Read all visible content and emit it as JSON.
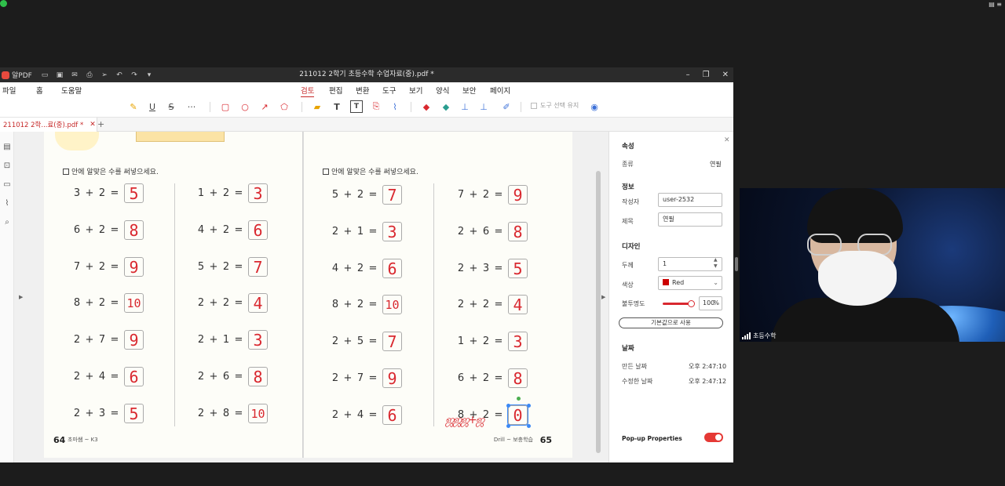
{
  "app": {
    "name": "알PDF",
    "window_title": "211012 2학기 초등수학 수업자료(중).pdf *"
  },
  "menu": [
    "파일",
    "홈",
    "도움말",
    "검토",
    "편집",
    "변환",
    "도구",
    "보기",
    "양식",
    "보안",
    "페이지"
  ],
  "menu_active": "검토",
  "toolbar": {
    "keep_tool_label": "도구 선택 유지"
  },
  "tab": {
    "label": "211012 2학...료(중).pdf *"
  },
  "left_page": {
    "instruction": "안에 알맞은 수를 써넣으세요.",
    "col1": [
      {
        "a": "3",
        "op": "+",
        "b": "2",
        "ans": "5"
      },
      {
        "a": "6",
        "op": "+",
        "b": "2",
        "ans": "8"
      },
      {
        "a": "7",
        "op": "+",
        "b": "2",
        "ans": "9"
      },
      {
        "a": "8",
        "op": "+",
        "b": "2",
        "ans": "10"
      },
      {
        "a": "2",
        "op": "+",
        "b": "7",
        "ans": "9"
      },
      {
        "a": "2",
        "op": "+",
        "b": "4",
        "ans": "6"
      },
      {
        "a": "2",
        "op": "+",
        "b": "3",
        "ans": "5"
      }
    ],
    "col2": [
      {
        "a": "1",
        "op": "+",
        "b": "2",
        "ans": "3"
      },
      {
        "a": "4",
        "op": "+",
        "b": "2",
        "ans": "6"
      },
      {
        "a": "5",
        "op": "+",
        "b": "2",
        "ans": "7"
      },
      {
        "a": "2",
        "op": "+",
        "b": "2",
        "ans": "4"
      },
      {
        "a": "2",
        "op": "+",
        "b": "1",
        "ans": "3"
      },
      {
        "a": "2",
        "op": "+",
        "b": "6",
        "ans": "8"
      },
      {
        "a": "2",
        "op": "+",
        "b": "8",
        "ans": "10"
      }
    ],
    "page_number": "64",
    "footer": "초마쌤 ~ K3"
  },
  "right_page": {
    "instruction": "안에 알맞은 수를 써넣으세요.",
    "col1": [
      {
        "a": "5",
        "op": "+",
        "b": "2",
        "ans": "7"
      },
      {
        "a": "2",
        "op": "+",
        "b": "1",
        "ans": "3"
      },
      {
        "a": "4",
        "op": "+",
        "b": "2",
        "ans": "6"
      },
      {
        "a": "8",
        "op": "+",
        "b": "2",
        "ans": "10"
      },
      {
        "a": "2",
        "op": "+",
        "b": "5",
        "ans": "7"
      },
      {
        "a": "2",
        "op": "+",
        "b": "7",
        "ans": "9"
      },
      {
        "a": "2",
        "op": "+",
        "b": "4",
        "ans": "6"
      }
    ],
    "col2": [
      {
        "a": "7",
        "op": "+",
        "b": "2",
        "ans": "9"
      },
      {
        "a": "2",
        "op": "+",
        "b": "6",
        "ans": "8"
      },
      {
        "a": "2",
        "op": "+",
        "b": "3",
        "ans": "5"
      },
      {
        "a": "2",
        "op": "+",
        "b": "2",
        "ans": "4"
      },
      {
        "a": "1",
        "op": "+",
        "b": "2",
        "ans": "3"
      },
      {
        "a": "6",
        "op": "+",
        "b": "2",
        "ans": "8"
      },
      {
        "a": "8",
        "op": "+",
        "b": "2",
        "ans": "0"
      }
    ],
    "page_number": "65",
    "footer": "Drill ~ 보충학습"
  },
  "properties": {
    "header": "속성",
    "type_label": "종류",
    "type_value": "연필",
    "info_header": "정보",
    "author_label": "작성자",
    "author_value": "user-2532",
    "subject_label": "제목",
    "subject_value": "연필",
    "design_header": "디자인",
    "thickness_label": "두께",
    "thickness_value": "1",
    "color_label": "색상",
    "color_value": "Red",
    "opacity_label": "불투명도",
    "opacity_value": "100",
    "opacity_unit": "%",
    "opacity_level": 1.0,
    "default_button": "기본값으로 사용",
    "date_header": "날짜",
    "created_label": "만든 날짜",
    "created_value": "오후 2:47:10",
    "modified_label": "수정한 날짜",
    "modified_value": "오후 2:47:12",
    "popup_label": "Pop-up Properties",
    "popup_on": true
  },
  "video": {
    "participant": "초등수학"
  },
  "colors": {
    "accent": "#c62828",
    "ink": "#d9282f",
    "toggle": "#e53935"
  }
}
